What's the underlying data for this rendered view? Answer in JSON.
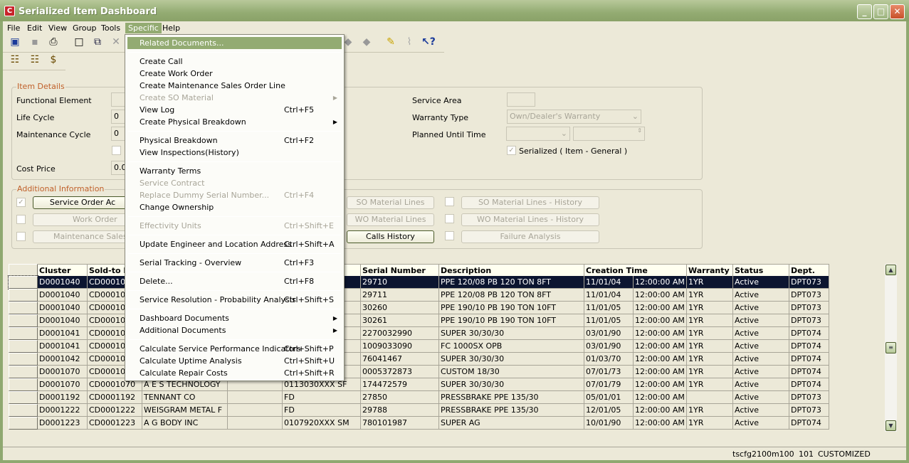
{
  "window": {
    "title": "Serialized Item Dashboard",
    "logo": "C",
    "controls": [
      "minimize",
      "maximize",
      "close"
    ]
  },
  "menubar": [
    "File",
    "Edit",
    "View",
    "Group",
    "Tools",
    "Specific",
    "Help"
  ],
  "active_menu": "Specific",
  "toolbar1": [
    "save-exit-icon",
    "save-icon",
    "print-icon",
    "new-icon",
    "copy-icon",
    "delete-icon",
    "nav-icon",
    "nav-icon",
    "edit-note-icon",
    "attach-icon",
    "help-pointer-icon"
  ],
  "toolbar2": [
    "dashboard-icon",
    "dashboard-doc-icon",
    "cost-icon"
  ],
  "item_details": {
    "title": "Item Details",
    "functional_element_label": "Functional Element",
    "functional_element": "",
    "life_cycle_label": "Life Cycle",
    "life_cycle": "0",
    "maintenance_cycle_label": "Maintenance Cycle",
    "maintenance_cycle": "0",
    "cost_price_label": "Cost Price",
    "cost_price": "0.0",
    "service_area_label": "Service Area",
    "service_area": "",
    "warranty_type_label": "Warranty Type",
    "warranty_type": "Own/Dealer's Warranty",
    "planned_until_label": "Planned Until Time",
    "serialized_label": "Serialized ( Item - General )",
    "serialized": true
  },
  "additional": {
    "title": "Additional Information",
    "buttons": [
      {
        "label": "Service Order Ac",
        "checked": true,
        "enabled": true
      },
      {
        "label": "Work Order",
        "checked": false,
        "enabled": false
      },
      {
        "label": "Maintenance Sales O",
        "checked": false,
        "enabled": false
      },
      {
        "label": "SO Material Lines",
        "enabled": false
      },
      {
        "label": "WO Material Lines",
        "enabled": false
      },
      {
        "label": "Calls History",
        "enabled": true
      },
      {
        "label": "SO Material Lines - History",
        "checked": false,
        "enabled": false
      },
      {
        "label": "WO Material Lines - History",
        "checked": false,
        "enabled": false
      },
      {
        "label": "Failure Analysis",
        "checked": false,
        "enabled": false
      }
    ]
  },
  "grid": {
    "headers": [
      "Cluster",
      "Sold-to B",
      "",
      "",
      "",
      "Serial Number",
      "Description",
      "Creation Time",
      "",
      "Warranty",
      "Status",
      "Dept."
    ],
    "rows": [
      [
        "D0001040",
        "CD000104",
        "",
        "",
        "",
        "29710",
        "PPE 120/08 PB 120 TON 8FT",
        "11/01/04",
        "12:00:00 AM",
        "1YR",
        "Active",
        "DPT073"
      ],
      [
        "D0001040",
        "CD000104",
        "",
        "",
        "",
        "29711",
        "PPE 120/08 PB 120 TON 8FT",
        "11/01/04",
        "12:00:00 AM",
        "1YR",
        "Active",
        "DPT073"
      ],
      [
        "D0001040",
        "CD000104",
        "",
        "",
        "",
        "30260",
        "PPE 190/10 PB 190 TON 10FT",
        "11/01/05",
        "12:00:00 AM",
        "1YR",
        "Active",
        "DPT073"
      ],
      [
        "D0001040",
        "CD000104",
        "",
        "",
        "",
        "30261",
        "PPE 190/10 PB 190 TON 10FT",
        "11/01/05",
        "12:00:00 AM",
        "1YR",
        "Active",
        "DPT073"
      ],
      [
        "D0001041",
        "CD000104",
        "",
        "",
        "",
        "2270032990",
        "SUPER 30/30/30",
        "03/01/90",
        "12:00:00 AM",
        "1YR",
        "Active",
        "DPT074"
      ],
      [
        "D0001041",
        "CD000104",
        "",
        "",
        "",
        "1009033090",
        "FC 1000SX OPB",
        "03/01/90",
        "12:00:00 AM",
        "1YR",
        "Active",
        "DPT074"
      ],
      [
        "D0001042",
        "CD000104",
        "",
        "",
        "",
        "76041467",
        "SUPER 30/30/30",
        "01/03/70",
        "12:00:00 AM",
        "1YR",
        "Active",
        "DPT074"
      ],
      [
        "D0001070",
        "CD000107",
        "",
        "",
        "",
        "0005372873",
        "CUSTOM 18/30",
        "07/01/73",
        "12:00:00 AM",
        "1YR",
        "Active",
        "DPT074"
      ],
      [
        "D0001070",
        "CD0001070",
        "A E S TECHNOLOGY",
        "",
        "0113030XXX SF",
        "174472579",
        "SUPER 30/30/30",
        "07/01/79",
        "12:00:00 AM",
        "1YR",
        "Active",
        "DPT074"
      ],
      [
        "D0001192",
        "CD0001192",
        "TENNANT CO",
        "",
        "FD",
        "27850",
        "PRESSBRAKE PPE 135/30",
        "05/01/01",
        "12:00:00 AM",
        "",
        "Active",
        "DPT073"
      ],
      [
        "D0001222",
        "CD0001222",
        "WEISGRAM METAL F",
        "",
        "FD",
        "29788",
        "PRESSBRAKE PPE 135/30",
        "12/01/05",
        "12:00:00 AM",
        "1YR",
        "Active",
        "DPT073"
      ],
      [
        "D0001223",
        "CD0001223",
        "A G BODY INC",
        "",
        "0107920XXX SM",
        "780101987",
        "SUPER AG",
        "10/01/90",
        "12:00:00 AM",
        "1YR",
        "Active",
        "DPT074"
      ]
    ],
    "selected_row": 0
  },
  "menu": [
    {
      "label": "Related Documents...",
      "highlight": true
    },
    {
      "sep": true
    },
    {
      "label": "Create Call"
    },
    {
      "label": "Create Work Order"
    },
    {
      "label": "Create Maintenance Sales Order Line"
    },
    {
      "label": "Create SO Material",
      "disabled": true,
      "submenu": true
    },
    {
      "label": "View Log",
      "shortcut": "Ctrl+F5"
    },
    {
      "label": "Create Physical Breakdown",
      "submenu": true
    },
    {
      "sep": true
    },
    {
      "label": "Physical Breakdown",
      "shortcut": "Ctrl+F2"
    },
    {
      "label": "View Inspections(History)"
    },
    {
      "sep": true
    },
    {
      "label": "Warranty Terms"
    },
    {
      "label": "Service Contract",
      "disabled": true
    },
    {
      "label": "Replace Dummy Serial Number...",
      "shortcut": "Ctrl+F4",
      "disabled": true
    },
    {
      "label": "Change Ownership"
    },
    {
      "sep": true
    },
    {
      "label": "Effectivity Units",
      "shortcut": "Ctrl+Shift+E",
      "disabled": true
    },
    {
      "sep": true
    },
    {
      "label": "Update Engineer and Location Address",
      "shortcut": "Ctrl+Shift+A"
    },
    {
      "sep": true
    },
    {
      "label": "Serial Tracking - Overview",
      "shortcut": "Ctrl+F3"
    },
    {
      "sep": true
    },
    {
      "label": "Delete...",
      "shortcut": "Ctrl+F8"
    },
    {
      "sep": true
    },
    {
      "label": "Service Resolution - Probability Analysis",
      "shortcut": "Ctrl+Shift+S"
    },
    {
      "sep": true
    },
    {
      "label": "Dashboard Documents",
      "submenu": true
    },
    {
      "label": "Additional Documents",
      "submenu": true
    },
    {
      "sep": true
    },
    {
      "label": "Calculate Service Performance Indicators",
      "shortcut": "Ctrl+Shift+P"
    },
    {
      "label": "Calculate Uptime Analysis",
      "shortcut": "Ctrl+Shift+U"
    },
    {
      "label": "Calculate Repair Costs",
      "shortcut": "Ctrl+Shift+R"
    }
  ],
  "status": {
    "session": "tscfg2100m100",
    "company": "101",
    "mode": "CUSTOMIZED"
  }
}
